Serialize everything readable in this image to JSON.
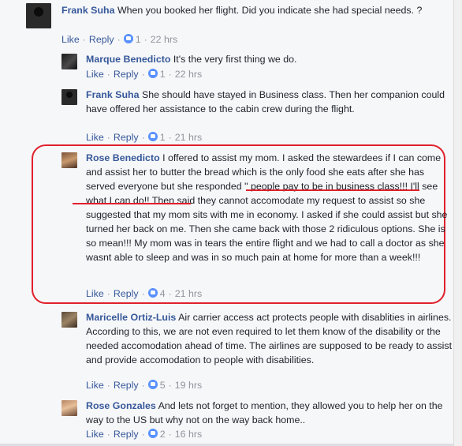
{
  "comments": [
    {
      "name": "Frank Suha",
      "text": "When you booked her flight. Did you indicate she had special needs. ?",
      "like": "Like",
      "reply": "Reply",
      "likes": "1",
      "time": "22 hrs"
    },
    {
      "name": "Marque Benedicto",
      "text": "It's the very first thing we do.",
      "like": "Like",
      "reply": "Reply",
      "likes": "1",
      "time": "22 hrs"
    },
    {
      "name": "Frank Suha",
      "text": "She should have stayed in Business class. Then her companion could have offered her assistance to the cabin crew during the flight.",
      "like": "Like",
      "reply": "Reply",
      "likes": "1",
      "time": "21 hrs"
    },
    {
      "name": "Rose Benedicto",
      "text": "I offered to assist my mom. I asked the stewardees if I can come and assist her to butter the bread which is the only food she eats after she has served everyone but she responded \" people pay to be in business class!!! I'll see what I can do!! Then said they cannot accomodate my request to assist so she suggested that my mom sits with me in economy. I asked if she could assist but she turned her back on me. Then she came back with those 2 ridiculous options. She is so mean!!! My mom was in tears the entire flight and we had to call a doctor as she wasnt able to sleep and was in so much pain at home for more than a week!!!",
      "like": "Like",
      "reply": "Reply",
      "likes": "4",
      "time": "21 hrs"
    },
    {
      "name": "Maricelle Ortiz-Luis",
      "text": "Air carrier access act protects people with disablities in airlines. According to this, we are not even required to let them know of the disability or the needed accomodation ahead of time. The airlines are supposed to be ready to assist and provide accomodation to people with disabilities.",
      "like": "Like",
      "reply": "Reply",
      "likes": "5",
      "time": "19 hrs"
    },
    {
      "name": "Rose Gonzales",
      "text": "And lets not forget to mention, they allowed you to help her on the way to the US but why not on the way back home..",
      "like": "Like",
      "reply": "Reply",
      "likes": "2",
      "time": "16 hrs"
    }
  ],
  "colors": {
    "name_link": "#365899",
    "highlight": "#e0202c",
    "like_badge": "#5890ff"
  },
  "icons": [
    "like-icon"
  ]
}
